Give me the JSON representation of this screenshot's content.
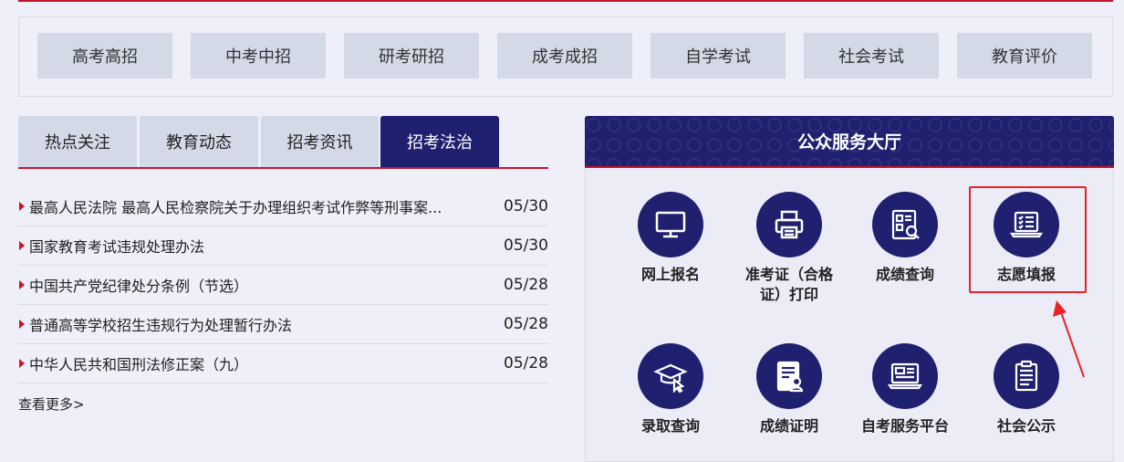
{
  "exam_categories": [
    "高考高招",
    "中考中招",
    "研考研招",
    "成考成招",
    "自学考试",
    "社会考试",
    "教育评价"
  ],
  "tabs": {
    "items": [
      "热点关注",
      "教育动态",
      "招考资讯",
      "招考法治"
    ],
    "active_index": 3
  },
  "news": [
    {
      "title": "最高人民法院 最高人民检察院关于办理组织考试作弊等刑事案...",
      "date": "05/30"
    },
    {
      "title": "国家教育考试违规处理办法",
      "date": "05/30"
    },
    {
      "title": "中国共产党纪律处分条例（节选）",
      "date": "05/28"
    },
    {
      "title": "普通高等学校招生违规行为处理暂行办法",
      "date": "05/28"
    },
    {
      "title": "中华人民共和国刑法修正案（九）",
      "date": "05/28"
    }
  ],
  "more_label": "查看更多>",
  "service_hall": {
    "title": "公众服务大厅",
    "services": [
      {
        "label": "网上报名",
        "icon": "monitor-icon"
      },
      {
        "label": "准考证（合格证）打印",
        "icon": "printer-icon"
      },
      {
        "label": "成绩查询",
        "icon": "score-search-icon"
      },
      {
        "label": "志愿填报",
        "icon": "checklist-laptop-icon",
        "highlighted": true
      },
      {
        "label": "录取查询",
        "icon": "graduation-cap-icon"
      },
      {
        "label": "成绩证明",
        "icon": "certificate-icon"
      },
      {
        "label": "自考服务平台",
        "icon": "online-service-icon"
      },
      {
        "label": "社会公示",
        "icon": "clipboard-icon"
      }
    ]
  },
  "colors": {
    "navy": "#1f2170",
    "red": "#c4162a",
    "annotation_red": "#e8232a",
    "button_bg": "#d4d9e8"
  }
}
